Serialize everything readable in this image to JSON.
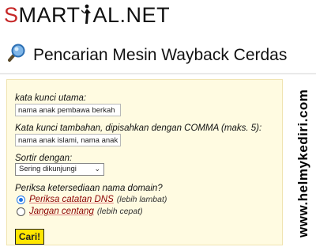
{
  "header": {
    "logo_left": "S",
    "logo_mid": "MART",
    "logo_right": "AL.NET"
  },
  "page_title": "Pencarian Mesin Wayback Cerdas",
  "icons": {
    "title_icon": "magnifier-icon",
    "logo_figure": "figure-icon"
  },
  "form": {
    "main_keyword": {
      "label": "kata kunci utama:",
      "value": "nama anak pembawa berkah"
    },
    "extra_keywords": {
      "label": "Kata kunci tambahan, dipisahkan dengan COMMA (maks. 5):",
      "value": "nama anak islami, nama anak"
    },
    "sort": {
      "label": "Sortir dengan:",
      "value": "Sering dikunjungi"
    },
    "domain_check": {
      "label": "Periksa ketersediaan nama domain?",
      "options": [
        {
          "label": "Periksa catatan DNS",
          "note": "(lebih lambat)",
          "selected": true
        },
        {
          "label": "Jangan centang",
          "note": "(lebih cepat)",
          "selected": false
        }
      ]
    },
    "submit_label": "Cari!"
  },
  "watermark": "www.helmykediri.com",
  "colors": {
    "panel_bg": "#fffbe1",
    "button_bg": "#ffe600",
    "logo_red": "#c62828",
    "radio_accent": "#1a73e8"
  }
}
